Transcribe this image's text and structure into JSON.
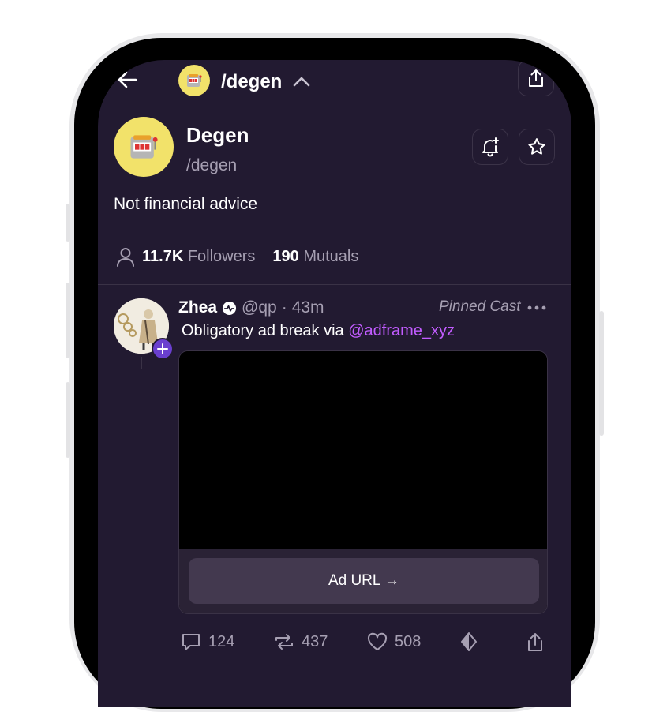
{
  "header": {
    "channel_path": "/degen",
    "back_icon": "arrow-left-icon",
    "share_icon": "share-icon",
    "collapse_icon": "chevron-up-icon"
  },
  "channel": {
    "name": "Degen",
    "handle": "/degen",
    "description": "Not financial advice",
    "followers_count": "11.7K",
    "followers_label": "Followers",
    "mutuals_count": "190",
    "mutuals_label": "Mutuals",
    "avatar_icon": "slot-machine-icon"
  },
  "cast": {
    "author_name": "Zhea",
    "author_handle": "@qp",
    "separator": "·",
    "age": "43m",
    "pinned_label": "Pinned Cast",
    "text_prefix": "Obligatory ad break via ",
    "mention": "@adframe_xyz",
    "frame_button_label": "Ad URL →",
    "replies": "124",
    "recasts": "437",
    "likes": "508"
  },
  "colors": {
    "background": "#221a31",
    "accent": "#c25cff",
    "avatar_yellow": "#f2e26a",
    "muted_text": "#a69fb2"
  }
}
